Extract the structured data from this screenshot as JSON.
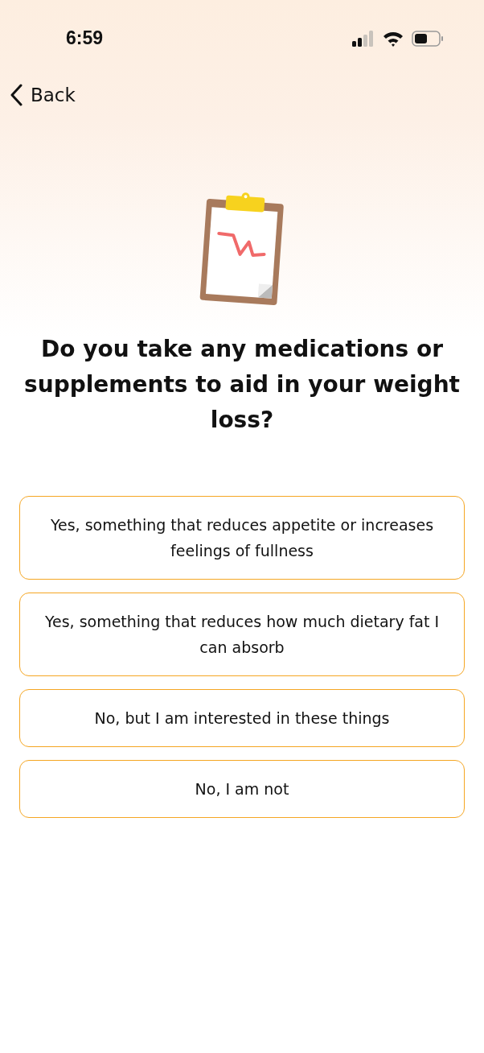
{
  "status_bar": {
    "time": "6:59"
  },
  "nav": {
    "back_label": "Back"
  },
  "question": "Do you take any medications or supplements to aid in your weight loss?",
  "options": [
    {
      "label": "Yes, something that reduces appetite or increases feelings of fullness"
    },
    {
      "label": "Yes, something that reduces how much dietary fat I can absorb"
    },
    {
      "label": "No, but I am interested in these things"
    },
    {
      "label": "No, I am not"
    }
  ]
}
